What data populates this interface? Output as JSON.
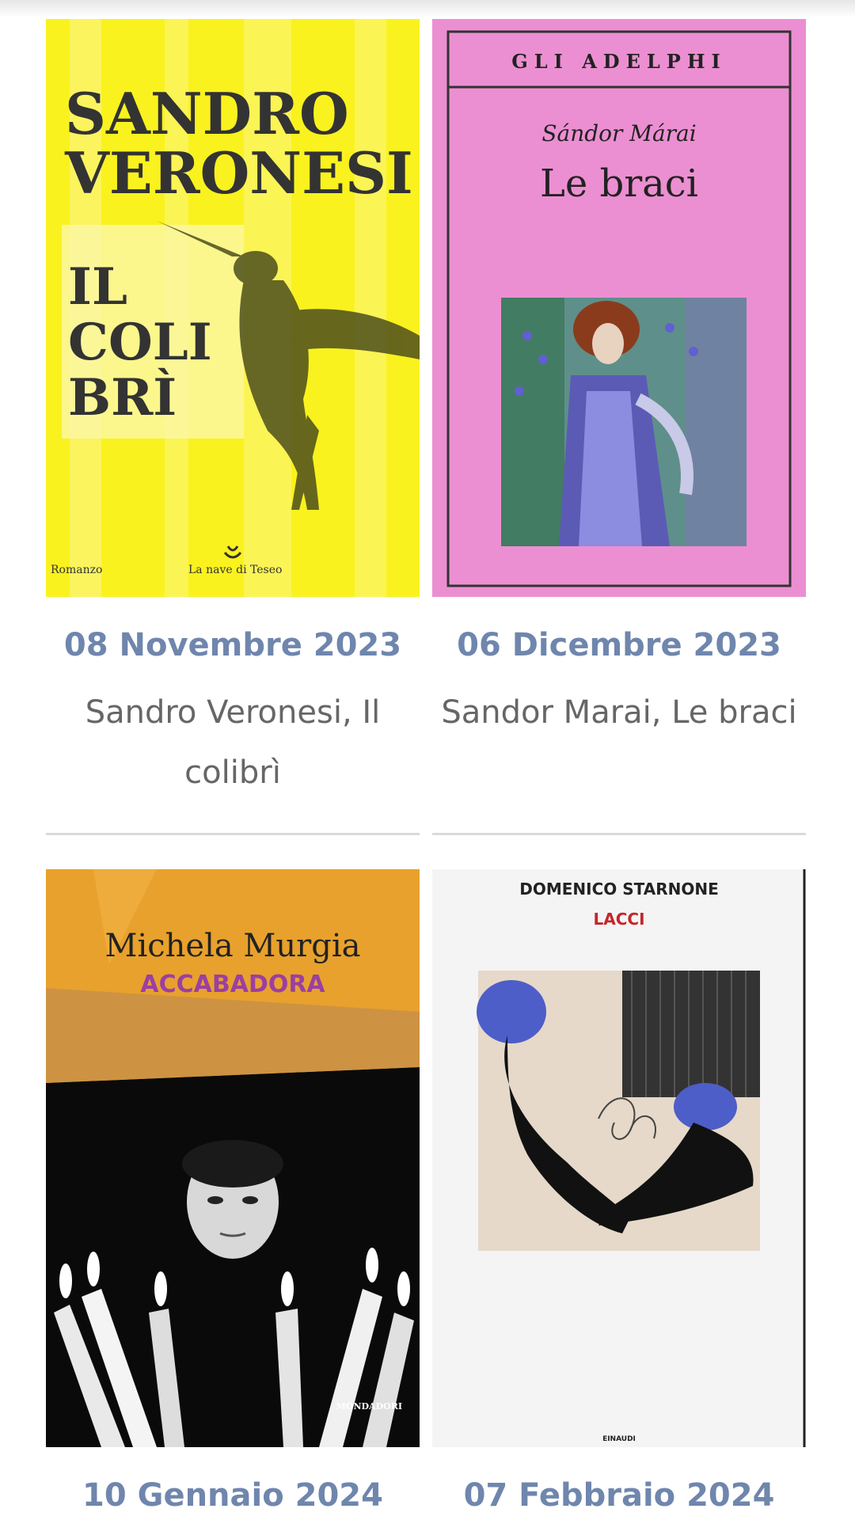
{
  "events": [
    {
      "date": "08 Novembre 2023",
      "title": "Sandro Veronesi, Il colibrì",
      "cover": {
        "author": "SANDRO VERONESI",
        "author_line1": "SANDRO",
        "author_line2": "VERONESI",
        "book_title_line1": "IL",
        "book_title_line2": "COLI",
        "book_title_line3": "BRÌ",
        "genre": "Romanzo",
        "publisher": "La nave di Teseo",
        "bg_color": "#faf21e"
      }
    },
    {
      "date": "06 Dicembre 2023",
      "title": "Sandor Marai, Le braci",
      "cover": {
        "series": "GLI ADELPHI",
        "author": "Sándor Márai",
        "book_title": "Le braci",
        "bg_color": "#ec8fd2"
      }
    },
    {
      "date": "10 Gennaio 2024",
      "title": "",
      "cover": {
        "author": "Michela Murgia",
        "book_title": "ACCABADORA",
        "publisher": "MONDADORI",
        "bg_color": "#e8a12c"
      }
    },
    {
      "date": "07 Febbraio 2024",
      "title": "",
      "cover": {
        "author": "DOMENICO STARNONE",
        "book_title": "LACCI",
        "publisher": "EINAUDI",
        "bg_color": "#f4f4f4"
      }
    }
  ],
  "colors": {
    "date": "#6f86ad",
    "title": "#666666",
    "divider": "#dadada"
  }
}
